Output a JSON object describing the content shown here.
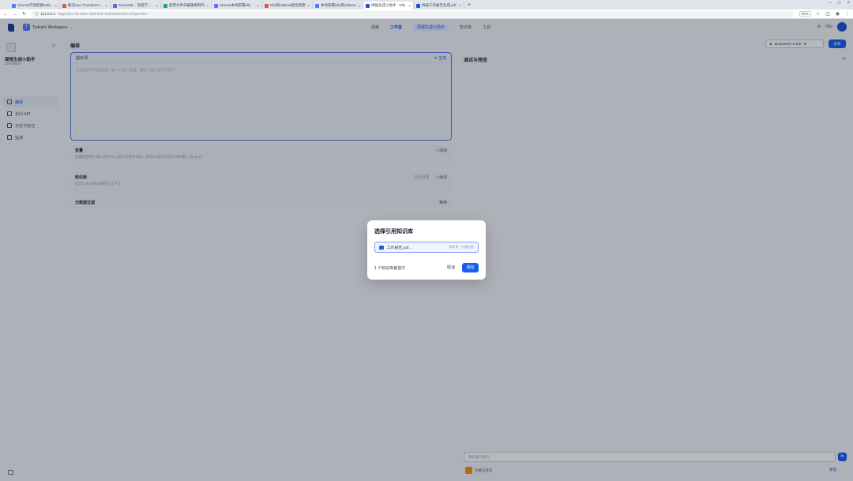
{
  "browser": {
    "tabs": [
      {
        "label": "Ubuntu环境搭建Dolly",
        "color": "#4f7cf2"
      },
      {
        "label": "解决Vue-ThunderFolder",
        "color": "#e2553a"
      },
      {
        "label": "TensorML - 深度学习工具",
        "color": "#5b6bd6"
      },
      {
        "label": "使用文件夹编辑来制作",
        "color": "#25a855"
      },
      {
        "label": "Ubuntu本地部署dify",
        "color": "#7b61ff"
      },
      {
        "label": "Dify和Ollama配合搭建",
        "color": "#e2553a"
      },
      {
        "label": "本地部署Dify和Ollama",
        "color": "#4f7cf2"
      },
      {
        "label": "周报生成小助手 · Dify",
        "color": "#1d4fd8"
      },
      {
        "label": "周报工作报告生成.pdf",
        "color": "#1d4fd8"
      }
    ],
    "active_tab_index": 7,
    "new_tab": "+",
    "url_host": "127.0.0.1",
    "url_path": "/app/2a1c7f3-4b8e-4b9f-9f4c-ba1f9b8cf0d0/configuration",
    "zoom": "90%"
  },
  "topnav": {
    "workspace_initial": "T",
    "workspace_name": "Tydeal's Workspace",
    "items": [
      "探索",
      "工作室",
      "知识库",
      "工具"
    ],
    "active_index": 1,
    "breadcrumb": "周报生成小助手",
    "user_name": "Dify"
  },
  "sidebar": {
    "app_name": "周报生成小助手",
    "app_type": "CHATBOT",
    "items": [
      "编排",
      "访问 API",
      "日志与标注",
      "监测"
    ],
    "active_index": 0
  },
  "editor": {
    "title": "编排",
    "prompt_label": "提示词",
    "generate_label": "生成",
    "prompt_placeholder": "在这里写你的提示词，输入'{' 插入变量、输入'/' 插入提示内容块",
    "prompt_count": "0",
    "variables": {
      "title": "变量",
      "add": "+ 添加",
      "desc": "变量能使用户输入表单引入提示词或开场白，你可以试试在提示词中输入 {{input}}"
    },
    "knowledge": {
      "title": "知识库",
      "recall": "召回设置",
      "add": "+ 添加",
      "desc": "您可以导入知识库作为上下文"
    },
    "metadata": {
      "title": "元数据过滤",
      "state": "禁用"
    }
  },
  "debug": {
    "title": "调试与预览",
    "model_name": "deepseek-r1:32b",
    "publish_label": "发布",
    "chat_placeholder": "和机器人聊天",
    "send_icon": "➤",
    "feature_label": "功能已开启",
    "manage_label": "管理"
  },
  "modal": {
    "title": "选择引用知识库",
    "kb_name": "工作报告.pdf...",
    "kb_meta": "高质量 · 向量检索",
    "selected_count": "1 个知识库被选中",
    "cancel": "取消",
    "add": "添加"
  },
  "colors": {
    "accent": "#155eef",
    "overlay": "rgba(16,24,40,0.30)"
  }
}
